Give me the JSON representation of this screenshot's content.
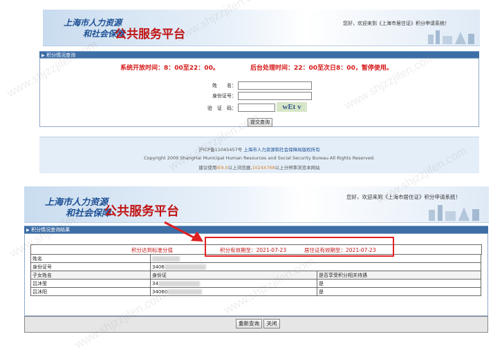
{
  "top": {
    "logo_line1": "上海市人力资源",
    "logo_line2": "和社会保障",
    "platform": "公共服务平台",
    "welcome": "您好，欢迎来到《上海市居住证》积分申请系统！",
    "section_title": "积分情况查询",
    "notice_open": "系统开放时间：8：00至22：00。",
    "notice_process": "后台处理时间：22：00至次日8：00，暂停使用。",
    "form": {
      "name_label": "姓　　名：",
      "id_label": "身份证号：",
      "captcha_label": "验　证　码：",
      "captcha_text": "wEt v",
      "submit": "提交查询"
    },
    "footer": {
      "line1_prefix": "沪ICP备11045457号",
      "line1_link": "上海市人力资源和社会保障局版权所有",
      "line2": "Copyright 2009 ShangHai Municipal Human Resources and Social Security Bureau All Rights Reserved.",
      "line3_a": "建议使用",
      "line3_b": "IE9.0",
      "line3_c": "以上浏览器,",
      "line3_d": "1024X768",
      "line3_e": "以上分辨率浏览本网站"
    }
  },
  "bottom": {
    "logo_line1": "上海市人力资源",
    "logo_line2": "和社会保障",
    "platform": "公共服务平台",
    "welcome": "您好，欢迎来到《上海市居住证》积分申请系统！",
    "section_title": "积分情况查询结果",
    "status_left": "积分达到标准分值",
    "valid_points": "积分有效期至：2021-07-23",
    "valid_residence": "居住证有效期至：2021-07-23",
    "rows": {
      "name_label": "姓名",
      "id_label": "身份证号",
      "id_prefix": "3406",
      "child_header": "子女姓名",
      "id_header": "身份证",
      "benefit_header": "是否享受积分相关待遇",
      "children": [
        {
          "name": "吕沐莹",
          "id_prefix": "34",
          "benefit": "是"
        },
        {
          "name": "吕沐阳",
          "id_prefix": "34060",
          "benefit": "是"
        }
      ]
    },
    "buttons": {
      "requery": "重新查询",
      "close": "关闭"
    }
  },
  "watermark": "www.shjzzjifen.com",
  "colors": {
    "accent_red": "#d61818",
    "bar_blue": "#3d6ea6",
    "logo_blue": "#1d4f94",
    "highlight_box": "#e02020"
  }
}
